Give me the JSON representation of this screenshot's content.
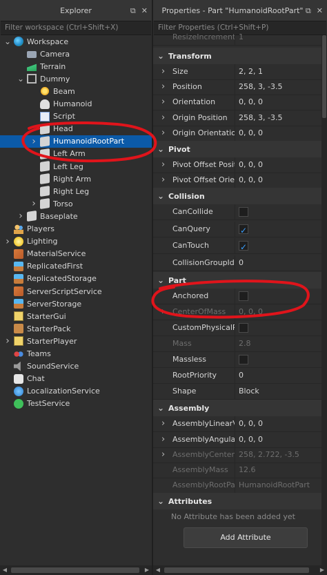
{
  "explorer": {
    "title": "Explorer",
    "filter_placeholder": "Filter workspace (Ctrl+Shift+X)",
    "nodes": [
      {
        "label": "Workspace",
        "icon": "workspace-globe-icon"
      },
      {
        "label": "Camera",
        "icon": "camera-icon"
      },
      {
        "label": "Terrain",
        "icon": "terrain-icon"
      },
      {
        "label": "Dummy",
        "icon": "model-icon"
      },
      {
        "label": "Beam",
        "icon": "beam-icon"
      },
      {
        "label": "Humanoid",
        "icon": "humanoid-icon"
      },
      {
        "label": "Script",
        "icon": "script-icon"
      },
      {
        "label": "Head",
        "icon": "part-icon"
      },
      {
        "label": "HumanoidRootPart",
        "icon": "part-icon"
      },
      {
        "label": "Left Arm",
        "icon": "part-icon"
      },
      {
        "label": "Left Leg",
        "icon": "part-icon"
      },
      {
        "label": "Right Arm",
        "icon": "part-icon"
      },
      {
        "label": "Right Leg",
        "icon": "part-icon"
      },
      {
        "label": "Torso",
        "icon": "part-icon"
      },
      {
        "label": "Baseplate",
        "icon": "part-icon"
      },
      {
        "label": "Players",
        "icon": "players-icon"
      },
      {
        "label": "Lighting",
        "icon": "lighting-icon"
      },
      {
        "label": "MaterialService",
        "icon": "material-service-icon"
      },
      {
        "label": "ReplicatedFirst",
        "icon": "replicated-first-icon"
      },
      {
        "label": "ReplicatedStorage",
        "icon": "replicated-storage-icon"
      },
      {
        "label": "ServerScriptService",
        "icon": "server-script-service-icon"
      },
      {
        "label": "ServerStorage",
        "icon": "server-storage-icon"
      },
      {
        "label": "StarterGui",
        "icon": "starter-gui-icon"
      },
      {
        "label": "StarterPack",
        "icon": "starter-pack-icon"
      },
      {
        "label": "StarterPlayer",
        "icon": "starter-player-icon"
      },
      {
        "label": "Teams",
        "icon": "teams-icon"
      },
      {
        "label": "SoundService",
        "icon": "sound-service-icon"
      },
      {
        "label": "Chat",
        "icon": "chat-icon"
      },
      {
        "label": "LocalizationService",
        "icon": "localization-service-icon"
      },
      {
        "label": "TestService",
        "icon": "test-service-icon"
      }
    ],
    "selected": "HumanoidRootPart"
  },
  "properties": {
    "title": "Properties - Part \"HumanoidRootPart\"",
    "filter_placeholder": "Filter Properties (Ctrl+Shift+P)",
    "top_row": {
      "name": "ResizeIncrement",
      "value": "1"
    },
    "sections": {
      "transform": "Transform",
      "pivot": "Pivot",
      "collision": "Collision",
      "part": "Part",
      "assembly": "Assembly",
      "attributes": "Attributes"
    },
    "transform": [
      {
        "name": "Size",
        "value": "2, 2, 1"
      },
      {
        "name": "Position",
        "value": "258, 3, -3.5"
      },
      {
        "name": "Orientation",
        "value": "0, 0, 0"
      },
      {
        "name": "Origin Position",
        "value": "258, 3, -3.5"
      },
      {
        "name": "Origin Orientation",
        "value": "0, 0, 0"
      }
    ],
    "pivot": [
      {
        "name": "Pivot Offset Position",
        "value": "0, 0, 0"
      },
      {
        "name": "Pivot Offset Orientation",
        "value": "0, 0, 0"
      }
    ],
    "collision": [
      {
        "name": "CanCollide",
        "checked": false
      },
      {
        "name": "CanQuery",
        "checked": true
      },
      {
        "name": "CanTouch",
        "checked": true
      },
      {
        "name": "CollisionGroupId",
        "value": "0"
      }
    ],
    "part": [
      {
        "name": "Anchored",
        "checked": false
      },
      {
        "name": "CenterOfMass",
        "value": "0, 0, 0"
      },
      {
        "name": "CustomPhysicalProperties",
        "checked": false
      },
      {
        "name": "Mass",
        "value": "2.8"
      },
      {
        "name": "Massless",
        "checked": false
      },
      {
        "name": "RootPriority",
        "value": "0"
      },
      {
        "name": "Shape",
        "value": "Block"
      }
    ],
    "assembly": [
      {
        "name": "AssemblyLinearVelocity",
        "value": "0, 0, 0"
      },
      {
        "name": "AssemblyAngularVelocity",
        "value": "0, 0, 0"
      },
      {
        "name": "AssemblyCenterOfMass",
        "value": "258, 2.722, -3.5"
      },
      {
        "name": "AssemblyMass",
        "value": "12.6"
      },
      {
        "name": "AssemblyRootPart",
        "value": "HumanoidRootPart"
      }
    ],
    "attributes_empty": "No Attribute has been added yet",
    "add_attribute_label": "Add Attribute"
  },
  "annotation_color": "#e0141b"
}
